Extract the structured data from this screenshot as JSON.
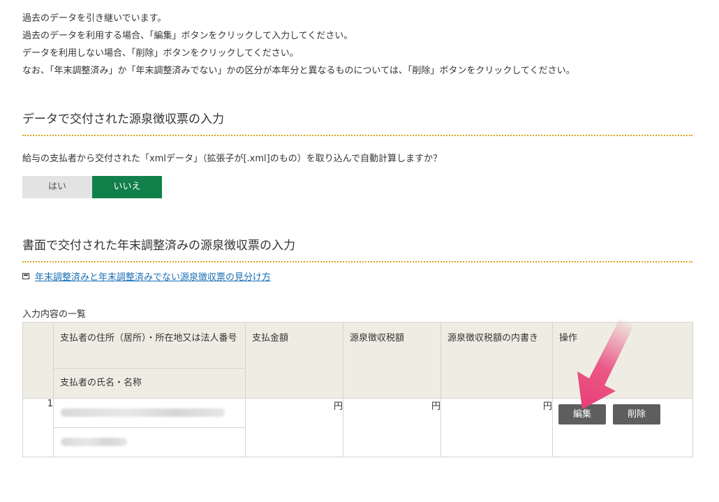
{
  "notice": {
    "line1": "過去のデータを引き継いでいます。",
    "line2": "過去のデータを利用する場合、「編集」ボタンをクリックして入力してください。",
    "line3": "データを利用しない場合、「削除」ボタンをクリックしてください。",
    "line4": "なお、「年末調整済み」か「年末調整済みでない」かの区分が本年分と異なるものについては、「削除」ボタンをクリックしてください。"
  },
  "section1": {
    "title": "データで交付された源泉徴収票の入力",
    "question": "給与の支払者から交付された「xmlデータ」（拡張子が[.xml]のもの）を取り込んで自動計算しますか？",
    "yes_label": "はい",
    "no_label": "いいえ",
    "selected": "いいえ",
    "selected_color": "#12804b"
  },
  "section2": {
    "title": "書面で交付された年末調整済みの源泉徴収票の入力",
    "guide_link": "年末調整済みと年末調整済みでない源泉徴収票の見分け方",
    "list_title": "入力内容の一覧",
    "table": {
      "headers": {
        "address": "支払者の住所（居所）・所在地又は法人番号",
        "name": "支払者の氏名・名称",
        "amount": "支払金額",
        "tax": "源泉徴収税額",
        "tax_detail": "源泉徴収税額の内書き",
        "operation": "操作"
      },
      "rows": [
        {
          "index": "1",
          "amount_unit": "円",
          "tax_unit": "円",
          "tax_detail_unit": "円",
          "edit_label": "編集",
          "delete_label": "削除"
        }
      ]
    }
  },
  "colors": {
    "accent_dotted": "#d9a419",
    "header_bg": "#efede3",
    "link": "#1a6fb5",
    "op_button": "#5e5e5e",
    "arrow": "#ea3f78"
  }
}
